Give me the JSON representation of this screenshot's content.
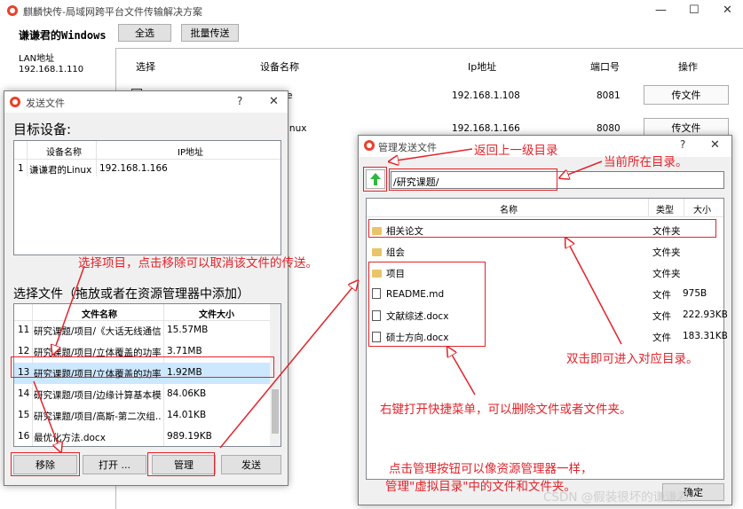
{
  "main": {
    "title": "麒麟快传-局域网跨平台文件传输解决方案",
    "host_name": "谦谦君的Windows",
    "select_all": "全选",
    "batch_send": "批量传送",
    "lan_label": "LAN地址",
    "lan_ip": "192.168.1.110",
    "columns": [
      "选择",
      "设备名称",
      "Ip地址",
      "端口号",
      "操作"
    ],
    "rows": [
      {
        "ip": "192.168.1.108",
        "port": "8081",
        "action": "传文件",
        "name_frag": "e"
      },
      {
        "ip": "192.168.1.166",
        "port": "8080",
        "action": "传文件",
        "name_frag": "inux"
      }
    ]
  },
  "send_dialog": {
    "title": "发送文件",
    "help": "?",
    "target_label": "目标设备:",
    "target_cols": [
      "设备名称",
      "IP地址"
    ],
    "targets": [
      {
        "idx": "1",
        "name": "谦谦君的Linux",
        "ip": "192.168.1.166"
      }
    ],
    "files_label": "选择文件（拖放或者在资源管理器中添加）",
    "file_cols": [
      "文件名称",
      "文件大小"
    ],
    "files": [
      {
        "idx": "11",
        "name": "研究课题/项目/《大话无线通信...",
        "size": "15.57MB"
      },
      {
        "idx": "12",
        "name": "研究课题/项目/立体覆盖的功率...",
        "size": "3.71MB"
      },
      {
        "idx": "13",
        "name": "研究课题/项目/立体覆盖的功率...",
        "size": "1.92MB"
      },
      {
        "idx": "14",
        "name": "研究课题/项目/边缘计算基本模...",
        "size": "84.06KB"
      },
      {
        "idx": "15",
        "name": "研究课题/项目/高斯-第二次组...",
        "size": "14.01KB"
      },
      {
        "idx": "16",
        "name": "最优化方法.docx",
        "size": "989.19KB"
      }
    ],
    "buttons": {
      "remove": "移除",
      "open": "打开 ...",
      "manage": "管理",
      "send": "发送"
    }
  },
  "manage_dialog": {
    "title": "管理发送文件",
    "help": "?",
    "path": "/研究课题/",
    "cols": [
      "名称",
      "类型",
      "大小"
    ],
    "items": [
      {
        "kind": "folder",
        "name": "相关论文",
        "type": "文件夹",
        "size": ""
      },
      {
        "kind": "folder",
        "name": "组会",
        "type": "文件夹",
        "size": ""
      },
      {
        "kind": "folder",
        "name": "项目",
        "type": "文件夹",
        "size": ""
      },
      {
        "kind": "file",
        "name": "README.md",
        "type": "文件",
        "size": "975B"
      },
      {
        "kind": "file",
        "name": "文献综述.docx",
        "type": "文件",
        "size": "222.93KB"
      },
      {
        "kind": "file",
        "name": "硕士方向.docx",
        "type": "文件",
        "size": "183.31KB"
      }
    ],
    "ok_frag": "确定"
  },
  "annotations": {
    "back": "返回上一级目录",
    "current": "当前所在目录。",
    "select_remove": "选择项目，点击移除可以取消该文件的传送。",
    "double_click": "双击即可进入对应目录。",
    "right_click": "右键打开快捷菜单，可以删除文件或者文件夹。",
    "manage_line1": "点击管理按钮可以像资源管理器一样，",
    "manage_line2": "管理\"虚拟目录\"中的文件和文件夹。"
  },
  "watermark": "CSDN @假装很坏的谦谦君",
  "colors": {
    "annotation": "#e2232a",
    "selected_row": "#cce8ff",
    "back_arrow": "#2db83d"
  }
}
